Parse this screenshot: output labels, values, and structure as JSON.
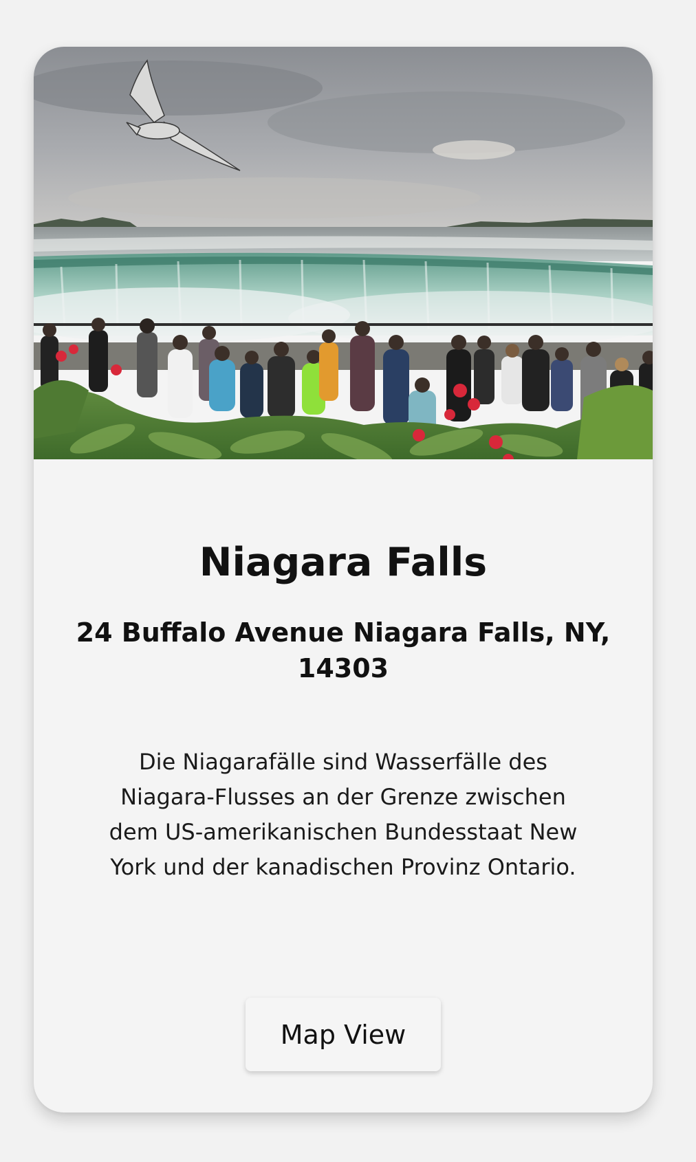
{
  "card": {
    "image_alt": "Niagara Falls with visitors at the railing",
    "title": "Niagara Falls",
    "address": "24 Buffalo Avenue Niagara Falls, NY, 14303",
    "description": "Die Niagarafälle sind Wasserfälle des Niagara-Flusses an der Grenze zwischen dem US-amerikanischen Bundesstaat New York und der kanadischen Provinz Ontario.",
    "button_label": "Map View"
  },
  "colors": {
    "page_background": "#f2f2f2",
    "card_background": "#f4f4f4",
    "text": "#111111"
  }
}
